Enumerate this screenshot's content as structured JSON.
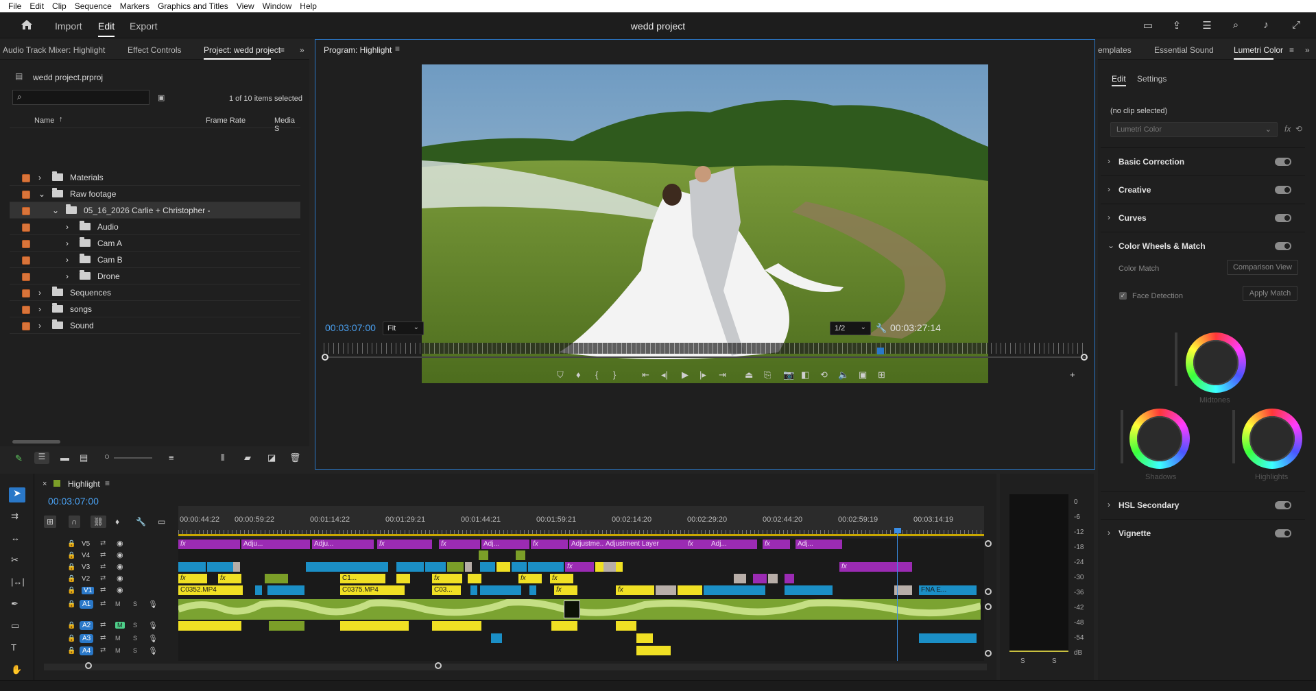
{
  "menu": [
    "File",
    "Edit",
    "Clip",
    "Sequence",
    "Markers",
    "Graphics and Titles",
    "View",
    "Window",
    "Help"
  ],
  "workspaces": {
    "import": "Import",
    "edit": "Edit",
    "export": "Export"
  },
  "project_title": "wedd project",
  "left_panel": {
    "tabs": [
      "Audio Track Mixer: Highlight",
      "Effect Controls",
      "Project: wedd project"
    ],
    "file": "wedd project.prproj",
    "items_selected": "1 of 10 items selected",
    "columns": {
      "name": "Name",
      "frame_rate": "Frame Rate",
      "media": "Media S"
    },
    "rows": [
      {
        "name": "Materials",
        "level": 0,
        "open": false
      },
      {
        "name": "Raw footage",
        "level": 0,
        "open": true
      },
      {
        "name": "05_16_2026 Carlie + Christopher -",
        "level": 1,
        "open": true
      },
      {
        "name": "Audio",
        "level": 2,
        "open": false
      },
      {
        "name": "Cam A",
        "level": 2,
        "open": false
      },
      {
        "name": "Cam B",
        "level": 2,
        "open": false
      },
      {
        "name": "Drone",
        "level": 2,
        "open": false
      },
      {
        "name": "Sequences",
        "level": 0,
        "open": false
      },
      {
        "name": "songs",
        "level": 0,
        "open": false
      },
      {
        "name": "Sound",
        "level": 0,
        "open": false
      }
    ]
  },
  "program": {
    "tab": "Program: Highlight",
    "timecode": "00:03:07:00",
    "fit": "Fit",
    "resolution": "1/2",
    "duration": "00:03:27:14"
  },
  "right_panel": {
    "tabs": [
      "emplates",
      "Essential Sound",
      "Lumetri Color"
    ],
    "subtabs": {
      "edit": "Edit",
      "settings": "Settings"
    },
    "no_clip": "(no clip selected)",
    "effect": "Lumetri Color",
    "sections": [
      "Basic Correction",
      "Creative",
      "Curves",
      "Color Wheels & Match"
    ],
    "color_match": "Color Match",
    "comparison_view": "Comparison View",
    "face_detection": "Face Detection",
    "apply_match": "Apply Match",
    "wheels": {
      "midtones": "Midtones",
      "shadows": "Shadows",
      "highlights": "Highlights"
    },
    "bottom_sections": [
      "HSL Secondary",
      "Vignette"
    ]
  },
  "timeline": {
    "tab": "Highlight",
    "timecode": "00:03:07:00",
    "ruler": [
      "00:00:44:22",
      "00:00:59:22",
      "00:01:14:22",
      "00:01:29:21",
      "00:01:44:21",
      "00:01:59:21",
      "00:02:14:20",
      "00:02:29:20",
      "00:02:44:20",
      "00:02:59:19",
      "00:03:14:19"
    ],
    "video_tracks": [
      "V5",
      "V4",
      "V3",
      "V2",
      "V1"
    ],
    "audio_tracks": [
      "A1",
      "A2",
      "A3",
      "A4"
    ],
    "clip_labels": {
      "adj1": "Adju...",
      "adj2": "Adju...",
      "adj3": "Adj...",
      "adj4": "Adjustme...",
      "adj5": "Adjustment Layer",
      "adj6": "Adj...",
      "adj7": "Adj...",
      "c0352": "C0352.MP4",
      "c0375": "C0375.MP4",
      "c03": "C03...",
      "c1": "C1...",
      "fna": "FNA E..."
    },
    "fx": "fx",
    "mute": "M",
    "solo": "S"
  },
  "meter": {
    "scale": [
      "0",
      "-6",
      "-12",
      "-18",
      "-24",
      "-30",
      "-36",
      "-42",
      "-48",
      "-54",
      "dB"
    ],
    "solo": [
      "S",
      "S"
    ]
  }
}
